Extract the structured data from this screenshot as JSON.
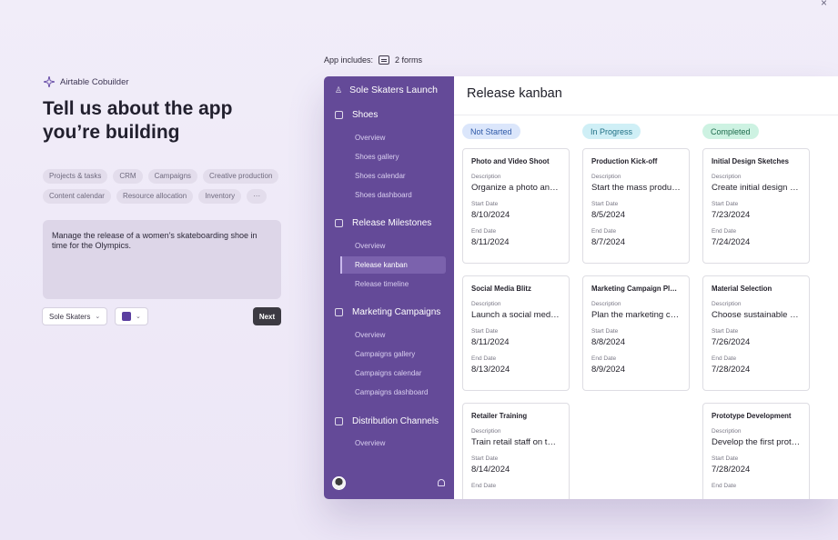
{
  "colors": {
    "sidebar": "#644a98",
    "accent": "#5b3fa0",
    "not_started_bg": "#dbe6fb",
    "not_started_fg": "#2f5aa8",
    "in_progress_bg": "#cfeff6",
    "in_progress_fg": "#1f6f84",
    "completed_bg": "#cdf2e2",
    "completed_fg": "#1e6b4d"
  },
  "close_icon": "×",
  "brand": {
    "label": "Airtable Cobuilder",
    "icon": "sparkle-icon"
  },
  "hero_title": "Tell us about the app you’re building",
  "chips": [
    "Projects & tasks",
    "CRM",
    "Campaigns",
    "Creative production",
    "Content calendar",
    "Resource allocation",
    "Inventory",
    "···"
  ],
  "prompt": "Manage the release of a women’s skateboarding shoe in time for the Olympics.",
  "controls": {
    "workspace_label": "Sole Skaters",
    "next_label": "Next"
  },
  "app_includes": {
    "label": "App includes:",
    "forms": "2 forms"
  },
  "sidebar": {
    "app_name": "Sole Skaters Launch",
    "sections": [
      {
        "label": "Shoes",
        "items": [
          "Overview",
          "Shoes gallery",
          "Shoes calendar",
          "Shoes dashboard"
        ]
      },
      {
        "label": "Release Milestones",
        "items": [
          "Overview",
          "Release kanban",
          "Release timeline"
        ]
      },
      {
        "label": "Marketing Campaigns",
        "items": [
          "Overview",
          "Campaigns gallery",
          "Campaigns calendar",
          "Campaigns dashboard"
        ]
      },
      {
        "label": "Distribution Channels",
        "items": [
          "Overview"
        ]
      }
    ]
  },
  "main": {
    "title": "Release kanban",
    "field_labels": {
      "description": "Description",
      "start": "Start Date",
      "end": "End Date"
    },
    "columns": [
      {
        "label": "Not Started",
        "cards": [
          {
            "title": "Photo and Video Shoot",
            "description": "Organize a photo and video shoot",
            "start": "8/10/2024",
            "end": "8/11/2024"
          },
          {
            "title": "Social Media Blitz",
            "description": "Launch a social media campaign",
            "start": "8/11/2024",
            "end": "8/13/2024"
          },
          {
            "title": "Retailer Training",
            "description": "Train retail staff on the new shoe",
            "start": "8/14/2024",
            "end": ""
          }
        ]
      },
      {
        "label": "In Progress",
        "cards": [
          {
            "title": "Production Kick-off",
            "description": "Start the mass production",
            "start": "8/5/2024",
            "end": "8/7/2024"
          },
          {
            "title": "Marketing Campaign Planning",
            "description": "Plan the marketing campaign",
            "start": "8/8/2024",
            "end": "8/9/2024"
          }
        ]
      },
      {
        "label": "Completed",
        "cards": [
          {
            "title": "Initial Design Sketches",
            "description": "Create initial design sketches",
            "start": "7/23/2024",
            "end": "7/24/2024"
          },
          {
            "title": "Material Selection",
            "description": "Choose sustainable and durable materials",
            "start": "7/26/2024",
            "end": "7/28/2024"
          },
          {
            "title": "Prototype Development",
            "description": "Develop the first prototype",
            "start": "7/28/2024",
            "end": ""
          }
        ]
      }
    ]
  }
}
